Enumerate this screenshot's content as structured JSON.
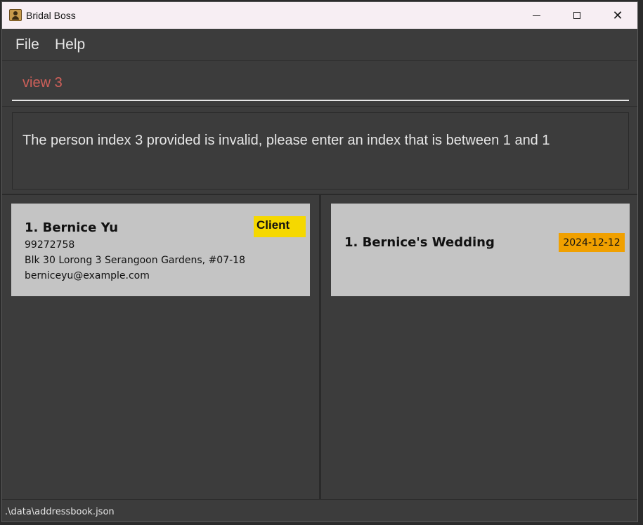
{
  "window": {
    "title": "Bridal Boss",
    "app_icon": "address-book-icon",
    "controls": [
      "minimize-icon",
      "maximize-icon",
      "close-icon"
    ],
    "close_glyph": "✕"
  },
  "menu": {
    "file_label": "File",
    "help_label": "Help"
  },
  "command": {
    "value": "view 3"
  },
  "result": {
    "message": "The person index 3 provided is invalid, please enter an index that is between 1 and 1"
  },
  "persons": [
    {
      "name": "1. Bernice Yu",
      "phone": "99272758",
      "address": "Blk 30 Lorong 3 Serangoon Gardens, #07-18",
      "email": "berniceyu@example.com",
      "tag": "Client",
      "tag_color": "#f5d800"
    }
  ],
  "weddings": [
    {
      "name": "1. Bernice's Wedding",
      "date": "2024-12-12",
      "date_color": "#f0a000"
    }
  ],
  "status": {
    "path": ".\\data\\addressbook.json"
  },
  "colors": {
    "background": "#3c3c3c",
    "card": "#c4c4c4",
    "command_text": "#d0605a",
    "title_bar": "#f7eef3"
  }
}
